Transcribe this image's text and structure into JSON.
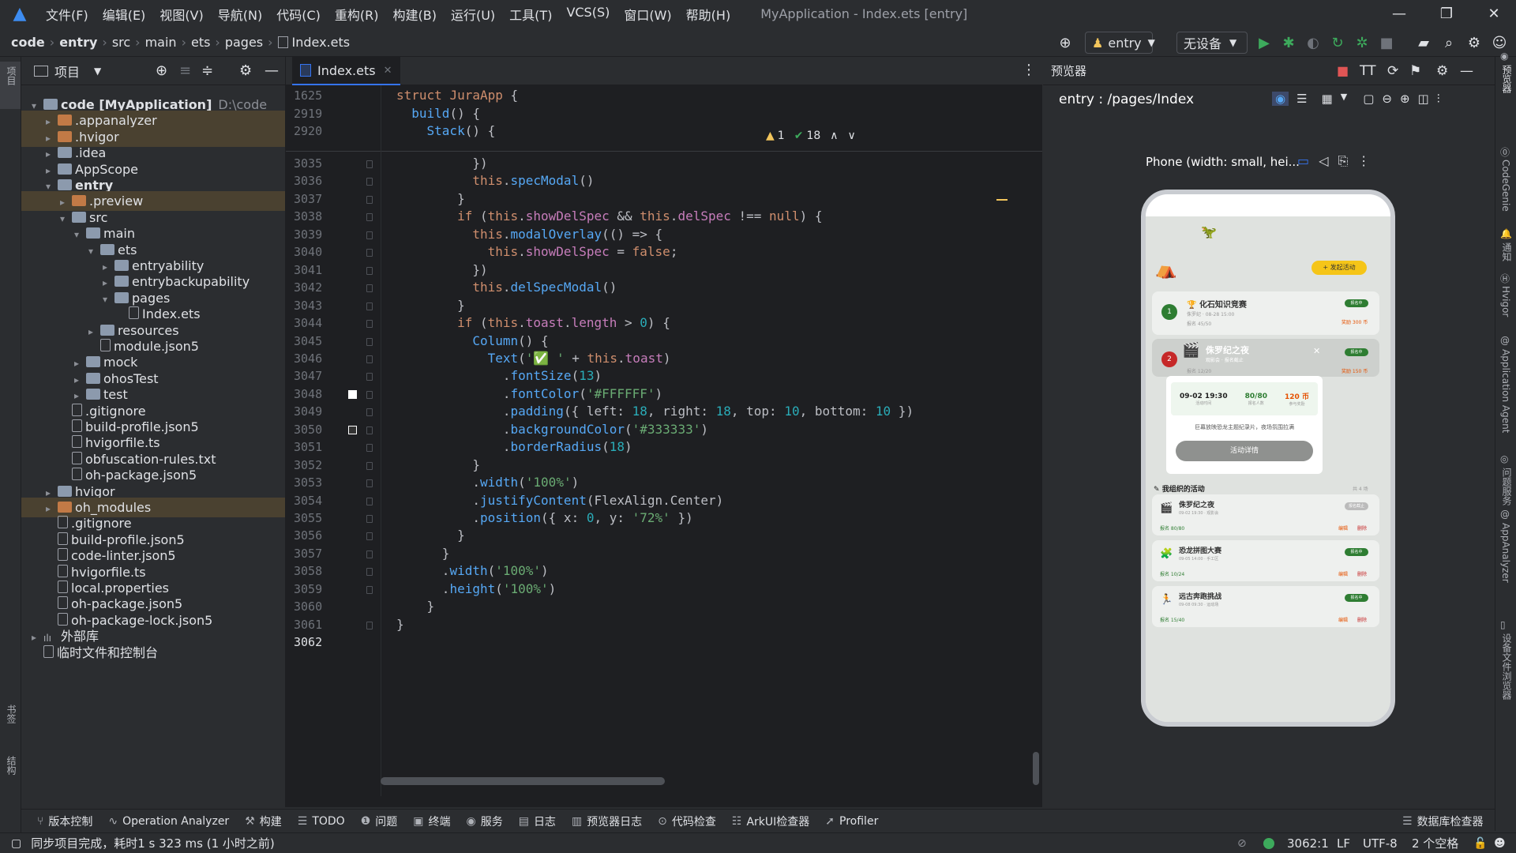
{
  "menubar": {
    "items": [
      "文件(F)",
      "编辑(E)",
      "视图(V)",
      "导航(N)",
      "代码(C)",
      "重构(R)",
      "构建(B)",
      "运行(U)",
      "工具(T)",
      "VCS(S)",
      "窗口(W)",
      "帮助(H)"
    ],
    "window_title": "MyApplication - Index.ets [entry]"
  },
  "breadcrumb": [
    "code",
    "entry",
    "src",
    "main",
    "ets",
    "pages",
    "Index.ets"
  ],
  "toolbar": {
    "run_config": "entry",
    "device": "无设备"
  },
  "left_strip": {
    "top_label": "项目",
    "bottom_labels": [
      "书签",
      "结构"
    ]
  },
  "project_panel": {
    "title": "项目",
    "tree": [
      {
        "label": "code [MyApplication]",
        "suffix": "D:\\code",
        "depth": 0,
        "expanded": true,
        "kind": "folder",
        "bold": true
      },
      {
        "label": ".appanalyzer",
        "depth": 1,
        "expanded": false,
        "kind": "folder-orange",
        "hl": true
      },
      {
        "label": ".hvigor",
        "depth": 1,
        "expanded": false,
        "kind": "folder-orange",
        "hl": true
      },
      {
        "label": ".idea",
        "depth": 1,
        "expanded": false,
        "kind": "folder"
      },
      {
        "label": "AppScope",
        "depth": 1,
        "expanded": false,
        "kind": "folder"
      },
      {
        "label": "entry",
        "depth": 1,
        "expanded": true,
        "kind": "folder",
        "bold": true
      },
      {
        "label": ".preview",
        "depth": 2,
        "expanded": false,
        "kind": "folder-orange",
        "hl": true
      },
      {
        "label": "src",
        "depth": 2,
        "expanded": true,
        "kind": "folder"
      },
      {
        "label": "main",
        "depth": 3,
        "expanded": true,
        "kind": "folder"
      },
      {
        "label": "ets",
        "depth": 4,
        "expanded": true,
        "kind": "folder"
      },
      {
        "label": "entryability",
        "depth": 5,
        "expanded": false,
        "kind": "folder"
      },
      {
        "label": "entrybackupability",
        "depth": 5,
        "expanded": false,
        "kind": "folder"
      },
      {
        "label": "pages",
        "depth": 5,
        "expanded": true,
        "kind": "folder"
      },
      {
        "label": "Index.ets",
        "depth": 6,
        "kind": "file"
      },
      {
        "label": "resources",
        "depth": 4,
        "expanded": false,
        "kind": "folder"
      },
      {
        "label": "module.json5",
        "depth": 4,
        "kind": "file"
      },
      {
        "label": "mock",
        "depth": 3,
        "expanded": false,
        "kind": "folder"
      },
      {
        "label": "ohosTest",
        "depth": 3,
        "expanded": false,
        "kind": "folder"
      },
      {
        "label": "test",
        "depth": 3,
        "expanded": false,
        "kind": "folder"
      },
      {
        "label": ".gitignore",
        "depth": 2,
        "kind": "file"
      },
      {
        "label": "build-profile.json5",
        "depth": 2,
        "kind": "file"
      },
      {
        "label": "hvigorfile.ts",
        "depth": 2,
        "kind": "file"
      },
      {
        "label": "obfuscation-rules.txt",
        "depth": 2,
        "kind": "file"
      },
      {
        "label": "oh-package.json5",
        "depth": 2,
        "kind": "file"
      },
      {
        "label": "hvigor",
        "depth": 1,
        "expanded": false,
        "kind": "folder"
      },
      {
        "label": "oh_modules",
        "depth": 1,
        "expanded": false,
        "kind": "folder-orange",
        "hl": true
      },
      {
        "label": ".gitignore",
        "depth": 1,
        "kind": "file"
      },
      {
        "label": "build-profile.json5",
        "depth": 1,
        "kind": "file"
      },
      {
        "label": "code-linter.json5",
        "depth": 1,
        "kind": "file"
      },
      {
        "label": "hvigorfile.ts",
        "depth": 1,
        "kind": "file"
      },
      {
        "label": "local.properties",
        "depth": 1,
        "kind": "file"
      },
      {
        "label": "oh-package.json5",
        "depth": 1,
        "kind": "file"
      },
      {
        "label": "oh-package-lock.json5",
        "depth": 1,
        "kind": "file"
      },
      {
        "label": "外部库",
        "depth": 0,
        "expanded": false,
        "kind": "lib"
      },
      {
        "label": "临时文件和控制台",
        "depth": 0,
        "kind": "console"
      }
    ]
  },
  "editor": {
    "tab": "Index.ets",
    "warnings": "1",
    "checks": "18",
    "sticky_lines": [
      {
        "n": "1625",
        "html": "<span class='kw'>struct</span> <span class='type' style='color:#cf8e6d'>JuraApp</span> {"
      },
      {
        "n": "2919",
        "html": "  <span class='fn'>build</span>() {"
      },
      {
        "n": "2920",
        "html": "    <span class='fn'>Stack</span>() {"
      }
    ],
    "lines": [
      {
        "n": "3035",
        "html": "          })"
      },
      {
        "n": "3036",
        "html": "          <span class='this'>this</span>.<span class='fn'>specModal</span>()"
      },
      {
        "n": "3037",
        "html": "        }"
      },
      {
        "n": "3038",
        "html": "        <span class='kw'>if</span> (<span class='this'>this</span>.<span class='prop'>showDelSpec</span> &amp;&amp; <span class='this'>this</span>.<span class='prop'>delSpec</span> !== <span class='kw'>null</span>) {"
      },
      {
        "n": "3039",
        "html": "          <span class='this'>this</span>.<span class='fn'>modalOverlay</span>(() => {"
      },
      {
        "n": "3040",
        "html": "            <span class='this'>this</span>.<span class='prop'>showDelSpec</span> = <span class='kw'>false</span>;"
      },
      {
        "n": "3041",
        "html": "          })"
      },
      {
        "n": "3042",
        "html": "          <span class='this'>this</span>.<span class='fn'>delSpecModal</span>()"
      },
      {
        "n": "3043",
        "html": "        }"
      },
      {
        "n": "3044",
        "html": "        <span class='kw'>if</span> (<span class='this'>this</span>.<span class='prop'>toast</span>.<span class='prop'>length</span> > <span class='num'>0</span>) {"
      },
      {
        "n": "3045",
        "html": "          <span class='fn'>Column</span>() {"
      },
      {
        "n": "3046",
        "html": "            <span class='fn'>Text</span>(<span class='str'>'✅ '</span> + <span class='this'>this</span>.<span class='prop'>toast</span>)"
      },
      {
        "n": "3047",
        "html": "              .<span class='fn'>fontSize</span>(<span class='num'>13</span>)"
      },
      {
        "n": "3048",
        "html": "              .<span class='fn'>fontColor</span>(<span class='str'>'#FFFFFF'</span>)"
      },
      {
        "n": "3049",
        "html": "              .<span class='fn'>padding</span>({ left: <span class='num'>18</span>, right: <span class='num'>18</span>, top: <span class='num'>10</span>, bottom: <span class='num'>10</span> })"
      },
      {
        "n": "3050",
        "html": "              .<span class='fn'>backgroundColor</span>(<span class='str'>'#333333'</span>)"
      },
      {
        "n": "3051",
        "html": "              .<span class='fn'>borderRadius</span>(<span class='num'>18</span>)"
      },
      {
        "n": "3052",
        "html": "          }"
      },
      {
        "n": "3053",
        "html": "          .<span class='fn'>width</span>(<span class='str'>'100%'</span>)"
      },
      {
        "n": "3054",
        "html": "          .<span class='fn'>justifyContent</span>(FlexAlign.Center)"
      },
      {
        "n": "3055",
        "html": "          .<span class='fn'>position</span>({ x: <span class='num'>0</span>, y: <span class='str'>'72%'</span> })"
      },
      {
        "n": "3056",
        "html": "        }"
      },
      {
        "n": "3057",
        "html": "      }"
      },
      {
        "n": "3058",
        "html": "      .<span class='fn'>width</span>(<span class='str'>'100%'</span>)"
      },
      {
        "n": "3059",
        "html": "      .<span class='fn'>height</span>(<span class='str'>'100%'</span>)"
      },
      {
        "n": "3060",
        "html": "    }"
      },
      {
        "n": "3061",
        "html": "}"
      },
      {
        "n": "3062",
        "html": ""
      }
    ]
  },
  "preview": {
    "panel_title": "预览器",
    "route": "entry : /pages/Index",
    "device_label": "Phone (width: small, hei...",
    "phone": {
      "add_button": "+ 发起活动",
      "cards": [
        {
          "rank": "1",
          "title": "化石知识竞赛",
          "sub": "侏罗纪 · 08-28 15:00",
          "meta": "报名 45/50",
          "reward": "奖励 300 币",
          "badge": "报名中"
        },
        {
          "rank": "2",
          "title": "侏罗纪之夜",
          "sub": "观影会 · 报名截止",
          "meta": "报名 12/20",
          "reward": "奖励 150 币",
          "badge": "报名中"
        }
      ],
      "modal": {
        "stats": [
          {
            "value": "09-02 19:30",
            "label": "活动时间"
          },
          {
            "value": "80/80",
            "label": "报名人数"
          },
          {
            "value": "120 币",
            "label": "参与奖励"
          }
        ],
        "desc": "巨幕放映恐龙主题纪录片，夜场氛围拉满",
        "button": "活动详情"
      },
      "section_title": "我组织的活动",
      "section_count": "共 4 场",
      "organized": [
        {
          "title": "侏罗纪之夜",
          "sub": "09-02 19:30 · 观影会",
          "meta": "报名 80/80",
          "badge": "报名截止",
          "actions": [
            "编辑",
            "删除"
          ]
        },
        {
          "title": "恐龙拼图大赛",
          "sub": "09-05 14:00 · 手工区",
          "meta": "报名 10/24",
          "badge": "报名中",
          "actions": [
            "编辑",
            "删除"
          ]
        },
        {
          "title": "远古奔跑挑战",
          "sub": "09-08 09:30 · 运动场",
          "meta": "报名 15/40",
          "badge": "报名中",
          "actions": [
            "编辑",
            "删除"
          ]
        }
      ]
    }
  },
  "right_strip": [
    "预览器",
    "CodeGenie",
    "通知",
    "Hvigor",
    "Application Agent",
    "问题服务",
    "AppAnalyzer",
    "设备文件浏览器"
  ],
  "bottom_tabs": [
    {
      "icon": "⑂",
      "label": "版本控制"
    },
    {
      "icon": "∿",
      "label": "Operation Analyzer"
    },
    {
      "icon": "⚒",
      "label": "构建"
    },
    {
      "icon": "☰",
      "label": "TODO"
    },
    {
      "icon": "❶",
      "label": "问题"
    },
    {
      "icon": "▣",
      "label": "终端"
    },
    {
      "icon": "◉",
      "label": "服务"
    },
    {
      "icon": "▤",
      "label": "日志"
    },
    {
      "icon": "▥",
      "label": "预览器日志"
    },
    {
      "icon": "⊙",
      "label": "代码检查"
    },
    {
      "icon": "☷",
      "label": "ArkUI检查器"
    },
    {
      "icon": "➚",
      "label": "Profiler"
    }
  ],
  "bottom_right_tab": "数据库检查器",
  "status": {
    "message": "同步项目完成，耗时1 s 323 ms (1 小时之前)",
    "position": "3062:1",
    "line_sep": "LF",
    "encoding": "UTF-8",
    "indent": "2 个空格"
  },
  "colors": {
    "accent": "#3574f0",
    "warn": "#f2c55c",
    "green": "#3daa5c",
    "phone_green": "#2e7d32",
    "gold": "#f5c518"
  }
}
